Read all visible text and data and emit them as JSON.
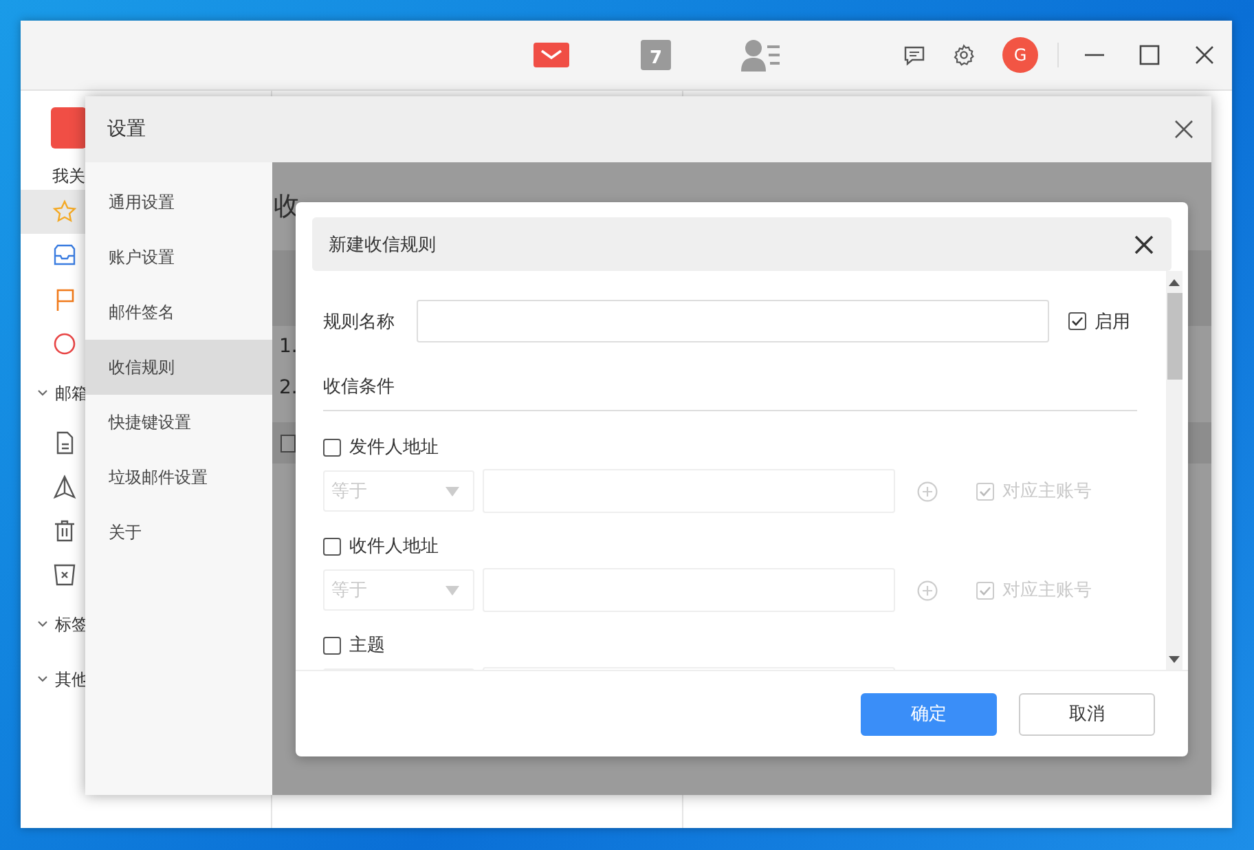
{
  "app": {
    "toolbar": {
      "modules": [
        {
          "kind": "mail",
          "selected": true
        },
        {
          "kind": "calendar",
          "selected": false,
          "label": "7"
        },
        {
          "kind": "contacts",
          "selected": false
        }
      ],
      "avatar": "G"
    },
    "sidebar": {
      "heading": "我关",
      "items": [
        {
          "kind": "star",
          "selected": true
        },
        {
          "kind": "inbox",
          "selected": false
        },
        {
          "kind": "flag",
          "selected": false
        },
        {
          "kind": "circle",
          "selected": false
        }
      ],
      "groups": [
        {
          "title": "邮箱",
          "expanded": true,
          "items": [
            {
              "kind": "draft",
              "selected": false
            },
            {
              "kind": "sent",
              "selected": false
            },
            {
              "kind": "trash",
              "selected": false
            },
            {
              "kind": "spam",
              "selected": false
            }
          ]
        },
        {
          "title": "标签",
          "expanded": true
        },
        {
          "title": "其他",
          "expanded": true
        }
      ]
    }
  },
  "settings": {
    "title": "设置",
    "nav": [
      {
        "label": "通用设置",
        "selected": false
      },
      {
        "label": "账户设置",
        "selected": false
      },
      {
        "label": "邮件签名",
        "selected": false
      },
      {
        "label": "收信规则",
        "selected": true
      },
      {
        "label": "快捷键设置",
        "selected": false
      },
      {
        "label": "垃圾邮件设置",
        "selected": false
      },
      {
        "label": "关于",
        "selected": false
      }
    ],
    "page": {
      "title": "收",
      "rows": [
        "1.",
        "2."
      ],
      "select_all": {
        "checked": false
      }
    }
  },
  "rule_dialog": {
    "title": "新建收信规则",
    "name_label": "规则名称",
    "enabled": {
      "label": "启用",
      "checked": true
    },
    "section": "收信条件",
    "conditions": [
      {
        "label": "发件人地址",
        "checked": false,
        "operator": "等于",
        "option": {
          "label": "对应主账号",
          "checked": true
        }
      },
      {
        "label": "收件人地址",
        "checked": false,
        "operator": "等于",
        "option": {
          "label": "对应主账号",
          "checked": true
        }
      },
      {
        "label": "主题",
        "checked": false
      }
    ],
    "buttons": [
      {
        "label": "确定",
        "kind": "primary"
      },
      {
        "label": "取消",
        "kind": "secondary"
      }
    ]
  }
}
